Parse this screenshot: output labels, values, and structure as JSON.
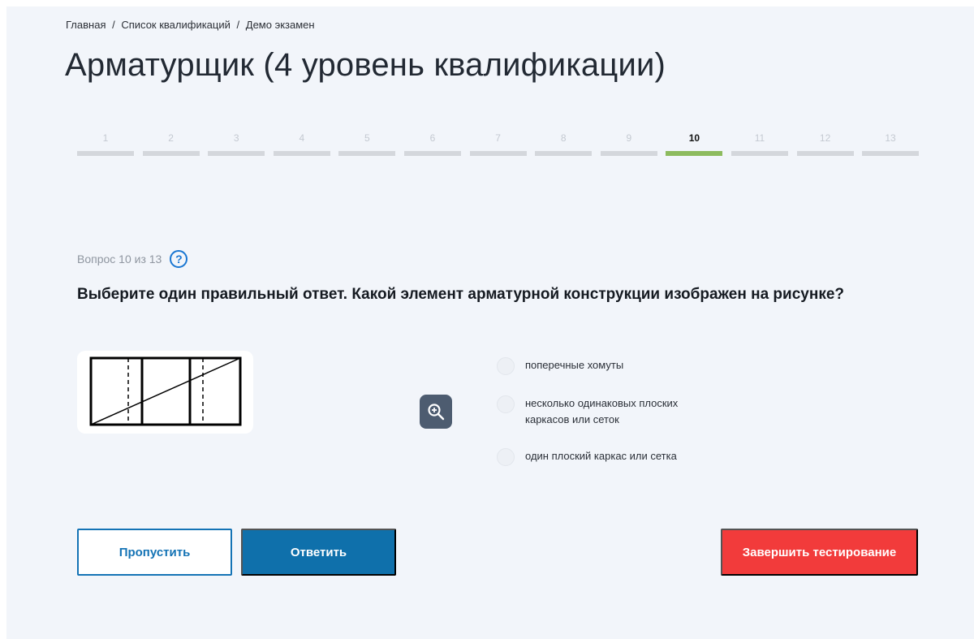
{
  "breadcrumb": {
    "items": [
      "Главная",
      "Список квалификаций",
      "Демо экзамен"
    ],
    "separator": "/"
  },
  "page_title": "Арматурщик (4 уровень квалификации)",
  "progress": {
    "steps": [
      "1",
      "2",
      "3",
      "4",
      "5",
      "6",
      "7",
      "8",
      "9",
      "10",
      "11",
      "12",
      "13"
    ],
    "current": 10,
    "active_color": "#8dbb5e",
    "inactive_color": "#d4d7dc"
  },
  "question": {
    "counter": "Вопрос 10 из 13",
    "help_icon": "question-circle-icon",
    "text": "Выберите один правильный ответ. Какой элемент арматурной конструкции изображен на рисунке?",
    "zoom_icon": "zoom-in-icon"
  },
  "options": [
    {
      "label": "поперечные хомуты",
      "selected": false
    },
    {
      "label": "несколько одинаковых плоских каркасов или сеток",
      "selected": false
    },
    {
      "label": "один плоский каркас или сетка",
      "selected": false
    }
  ],
  "buttons": {
    "skip": "Пропустить",
    "answer": "Ответить",
    "finish": "Завершить тестирование"
  },
  "colors": {
    "primary": "#0f70ab",
    "danger": "#f23b3b",
    "background": "#f2f5fa"
  }
}
